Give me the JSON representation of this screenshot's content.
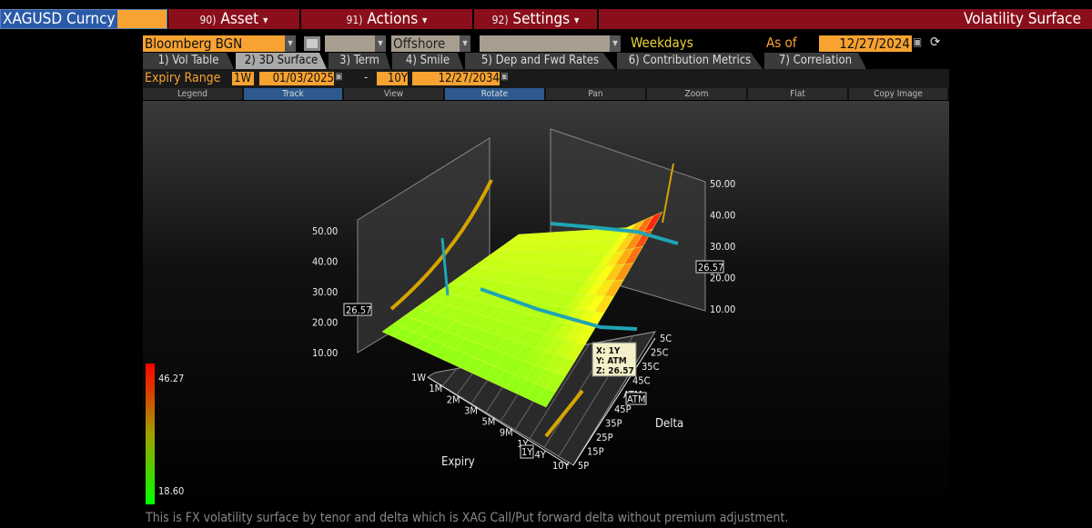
{
  "ticker": {
    "value": "XAGUSD Curncy"
  },
  "menu": [
    {
      "num": "90)",
      "label": "Asset"
    },
    {
      "num": "91)",
      "label": "Actions"
    },
    {
      "num": "92)",
      "label": "Settings"
    }
  ],
  "window_title": "Volatility Surface",
  "controls": {
    "source": "Bloomberg BGN",
    "location": "Offshore",
    "day_count": "Weekdays",
    "as_of_label": "As of",
    "as_of": "12/27/2024"
  },
  "tabs": [
    {
      "label": "1) Vol Table"
    },
    {
      "label": "2) 3D Surface",
      "active": true
    },
    {
      "label": "3) Term"
    },
    {
      "label": "4) Smile"
    },
    {
      "label": "5) Dep and Fwd Rates"
    },
    {
      "label": "6) Contribution Metrics"
    },
    {
      "label": "7) Correlation"
    }
  ],
  "expiry": {
    "label": "Expiry Range",
    "from_tenor": "1W",
    "from_date": "01/03/2025",
    "sep": "-",
    "to_tenor": "10Y",
    "to_date": "12/27/2034"
  },
  "toolbar": [
    {
      "label": "Legend"
    },
    {
      "label": "Track",
      "active": true
    },
    {
      "label": "View"
    },
    {
      "label": "Rotate",
      "active": true
    },
    {
      "label": "Pan"
    },
    {
      "label": "Zoom"
    },
    {
      "label": "Flat"
    },
    {
      "label": "Copy Image"
    }
  ],
  "chart": {
    "expiry_axis_title": "Expiry",
    "delta_axis_title": "Delta",
    "expiry_ticks": [
      "1W",
      "1M",
      "2M",
      "3M",
      "5M",
      "9M",
      "1Y",
      "4Y",
      "10Y"
    ],
    "delta_ticks": [
      "5P",
      "15P",
      "25P",
      "35P",
      "45P",
      "ATM",
      "45C",
      "35C",
      "25C",
      "5C"
    ],
    "z_ticks": [
      "10.00",
      "20.00",
      "30.00",
      "40.00",
      "50.00"
    ],
    "marker_z": "26.57",
    "marker_expiry": "1Y",
    "marker_delta": "ATM",
    "tooltip": {
      "x": "X:  1Y",
      "y": "Y:  ATM",
      "z": "Z:  26.57"
    },
    "colorbar": {
      "max": "46.27",
      "min": "18.60",
      "low_color": "#00ff00",
      "mid_color": "#ffff00",
      "high_color": "#ff0000"
    }
  },
  "footer": "This is FX volatility surface by tenor and delta which is XAG Call/Put forward delta without premium adjustment."
}
